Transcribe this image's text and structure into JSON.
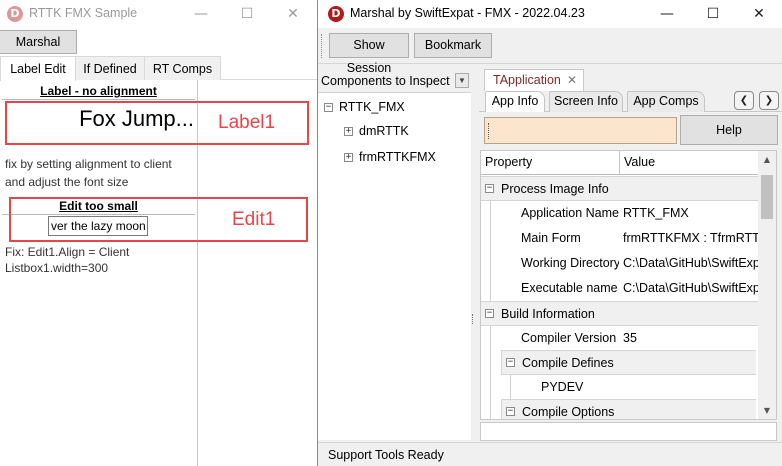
{
  "sample_window": {
    "title": "RTTK FMX Sample",
    "logo_letter": "D",
    "minimize_glyph": "—",
    "maximize_glyph": "☐",
    "close_glyph": "✕",
    "marshal_button": "Marshal",
    "tabs": [
      {
        "label": "Label  Edit"
      },
      {
        "label": "If Defined"
      },
      {
        "label": "RT Comps"
      }
    ],
    "label_section_title": "Label - no alignment",
    "label_text": "Fox Jump...",
    "label_annotation": "Label1",
    "label_note_line1": "fix by setting alignment to client",
    "label_note_line2": "and adjust the font size",
    "edit_section_title": "Edit too small",
    "edit_value": "ver the lazy moon",
    "edit_annotation": "Edit1",
    "edit_note_line1": "Fix: Edit1.Align = Client",
    "edit_note_line2": "Listbox1.width=300",
    "annotation_color": "#e8454b"
  },
  "marshal_window": {
    "title": "Marshal by SwiftExpat - FMX - 2022.04.23",
    "logo_letter": "D",
    "logo_color": "#b01c1c",
    "minimize_glyph": "—",
    "maximize_glyph": "☐",
    "close_glyph": "✕",
    "toolbar": {
      "show_session": "Show Session",
      "bookmark": "Bookmark"
    },
    "components_header": "Components to Inspect",
    "dropdown_glyph": "▼",
    "tree": {
      "root": "RTTK_FMX",
      "children": [
        "dmRTTK",
        "frmRTTKFMX"
      ],
      "collapse_glyph": "−",
      "expand_glyph": "+"
    },
    "outer_tab": "TApplication",
    "outer_tab_close": "✕",
    "inner_tabs": [
      "App Info",
      "Screen Info",
      "App Comps"
    ],
    "nav_prev": "❮",
    "nav_next": "❯",
    "help_button": "Help",
    "help_field_color": "#fbe6cd",
    "grid": {
      "col_property": "Property",
      "col_value": "Value",
      "cat_process": "Process Image Info",
      "cat_build": "Build Information",
      "sub_defines": "Compile Defines",
      "sub_options": "Compile Options",
      "define_pydev": "PYDEV",
      "rows": [
        {
          "prop": "Application Name",
          "value": "RTTK_FMX"
        },
        {
          "prop": "Main Form",
          "value": "frmRTTKFMX : TfrmRTTKFMX"
        },
        {
          "prop": "Working Directory",
          "value": "C:\\Data\\GitHub\\SwiftExpat"
        },
        {
          "prop": "Executable name",
          "value": "C:\\Data\\GitHub\\SwiftExpat"
        },
        {
          "prop": "Compiler Version",
          "value": "35"
        }
      ],
      "scroll_up": "▲",
      "scroll_down": "▼"
    },
    "status": "Support Tools Ready"
  }
}
